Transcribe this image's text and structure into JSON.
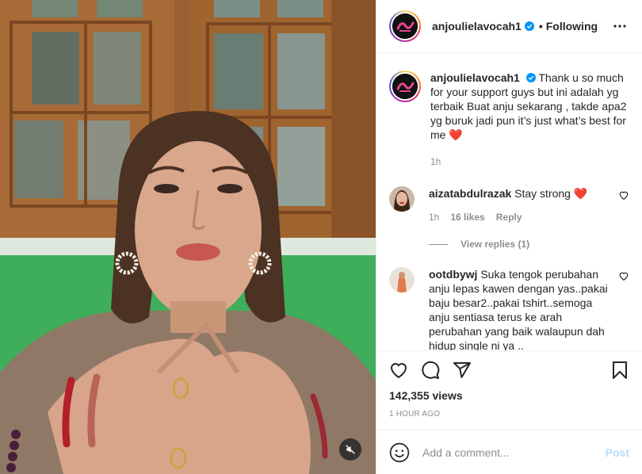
{
  "header": {
    "username": "anjoulielavocah1",
    "separator": "•",
    "follow_status": "Following"
  },
  "caption": {
    "username": "anjoulielavocah1",
    "text": "Thank u so much for your support guys but ini adalah yg terbaik Buat anju sekarang , takde apa2 yg buruk jadi pun it’s just what’s best for me",
    "emoji": "❤️",
    "time": "1h"
  },
  "comments": [
    {
      "username": "aizatabdulrazak",
      "text": "Stay strong",
      "emoji": "❤️",
      "time": "1h",
      "likes": "16 likes",
      "reply_label": "Reply",
      "view_replies": "View replies (1)"
    },
    {
      "username": "ootdbywj",
      "text": "Suka tengok perubahan anju lepas kawen dengan yas..pakai baju besar2..pakai tshirt..semoga anju sentiasa terus ke arah perubahan yang baik walaupun dah hidup single ni ya .."
    }
  ],
  "stats": {
    "views": "142,355 views",
    "timestamp": "1 HOUR AGO"
  },
  "composer": {
    "placeholder": "Add a comment...",
    "post_label": "Post"
  },
  "icons": {
    "verified": "verified-badge-icon",
    "more": "more-options-icon",
    "heart": "heart-icon",
    "comment": "comment-icon",
    "share": "share-icon",
    "save": "bookmark-icon",
    "emoji": "emoji-icon",
    "mute": "speaker-muted-icon"
  },
  "colors": {
    "verified_blue": "#0095f6",
    "post_disabled": "#b2dffc",
    "muted_text": "#8e8e8e",
    "heart_red": "#e0112a"
  }
}
